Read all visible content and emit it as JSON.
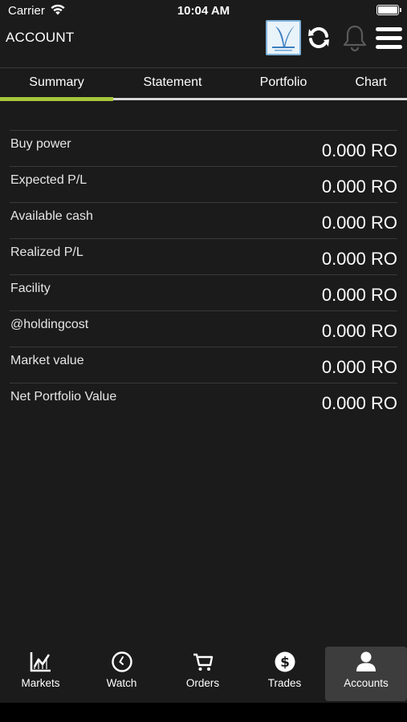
{
  "status_bar": {
    "carrier": "Carrier",
    "time": "10:04 AM"
  },
  "header": {
    "title": "ACCOUNT"
  },
  "tabs": [
    {
      "label": "Summary",
      "active": true
    },
    {
      "label": "Statement",
      "active": false
    },
    {
      "label": "Portfolio",
      "active": false
    },
    {
      "label": "Chart",
      "active": false
    }
  ],
  "summary": {
    "rows": [
      {
        "label": "Buy power",
        "value": "0.000 RO"
      },
      {
        "label": "Expected P/L",
        "value": "0.000 RO"
      },
      {
        "label": "Available cash",
        "value": "0.000 RO"
      },
      {
        "label": "Realized P/L",
        "value": "0.000 RO"
      },
      {
        "label": "Facility",
        "value": "0.000 RO"
      },
      {
        "label": "@holdingcost",
        "value": "0.000 RO"
      },
      {
        "label": "Market value",
        "value": "0.000 RO"
      },
      {
        "label": "Net Portfolio Value",
        "value": "0.000 RO"
      }
    ]
  },
  "bottom_nav": [
    {
      "label": "Markets",
      "icon": "chart-line-icon",
      "active": false
    },
    {
      "label": "Watch",
      "icon": "clock-icon",
      "active": false
    },
    {
      "label": "Orders",
      "icon": "cart-icon",
      "active": false
    },
    {
      "label": "Trades",
      "icon": "dollar-icon",
      "active": false
    },
    {
      "label": "Accounts",
      "icon": "user-icon",
      "active": true
    }
  ],
  "colors": {
    "background": "#1b1b1b",
    "accent": "#a7c73b",
    "active_nav_bg": "#3d3d3d"
  }
}
